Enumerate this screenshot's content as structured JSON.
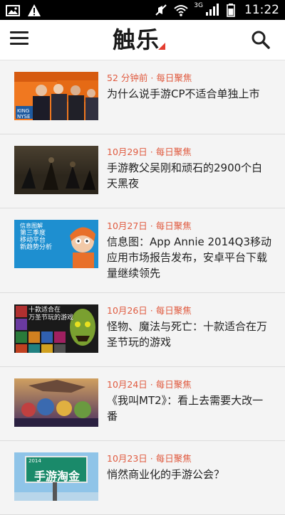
{
  "status_bar": {
    "time": "11:22",
    "network": "3G",
    "icons": [
      "image-icon",
      "warning-icon",
      "mute-icon",
      "wifi-icon",
      "signal-icon",
      "battery-icon"
    ]
  },
  "app_bar": {
    "logo_text": "触乐",
    "brand_color": "#e43d30",
    "icons": [
      "menu-icon",
      "search-icon"
    ]
  },
  "feed": {
    "items": [
      {
        "time": "52 分钟前",
        "sep": "·",
        "category": "每日聚焦",
        "title": "为什么说手游CP不适合单独上市"
      },
      {
        "time": "10月29日",
        "sep": "·",
        "category": "每日聚焦",
        "title": "手游教父吴刚和顽石的2900个白天黑夜"
      },
      {
        "time": "10月27日",
        "sep": "·",
        "category": "每日聚焦",
        "title": "信息图：App Annie 2014Q3移动应用市场报告发布，安卓平台下载量继续领先",
        "thumb_text": [
          "信息图解",
          "第三季度",
          "移动平台",
          "新趋势分析"
        ]
      },
      {
        "time": "10月26日",
        "sep": "·",
        "category": "每日聚焦",
        "title": "怪物、魔法与死亡：十款适合在万圣节玩的游戏",
        "thumb_text": [
          "十款适合在",
          "万圣节玩的游戏"
        ]
      },
      {
        "time": "10月24日",
        "sep": "·",
        "category": "每日聚焦",
        "title": "《我叫MT2》：看上去需要大改一番"
      },
      {
        "time": "10月23日",
        "sep": "·",
        "category": "每日聚焦",
        "title": "悄然商业化的手游公会？",
        "thumb_text": [
          "2014",
          "手游淘金"
        ]
      }
    ]
  }
}
